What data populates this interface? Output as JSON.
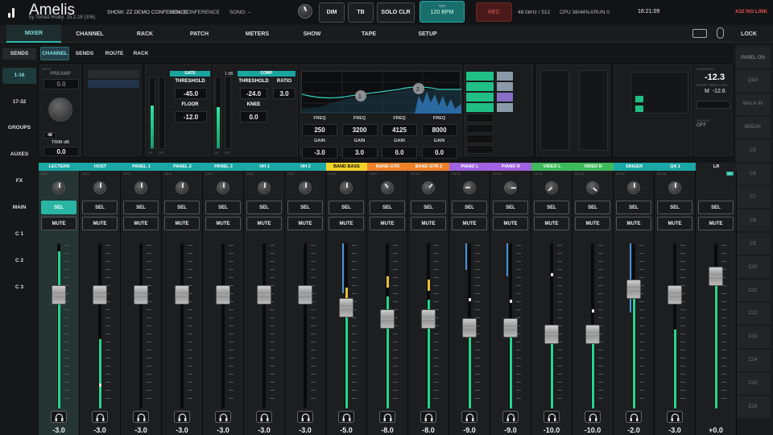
{
  "app": {
    "name": "Amelis",
    "by": "by Tomáš Hrubý",
    "version": "15.2.18 (306)",
    "show": "SHOW: ZZ DEMO CONFERENCE",
    "scene": "SCN: CONFERENCE",
    "song": "SONG: --",
    "dim": "DIM",
    "tb": "TB",
    "solo_clr": "SOLO CLR",
    "tap_label": "TAP",
    "bpm": "120 BPM",
    "rec": "REC",
    "samplerate": "48.0kHz / 512",
    "cpu": "CPU 38/44%",
    "xrun": "XRUN 0",
    "clock": "16:21:09",
    "link": "X32 NO LINK"
  },
  "nav": [
    "MIXER",
    "CHANNEL",
    "RACK",
    "PATCH",
    "METERS",
    "SHOW",
    "TAPE",
    "SETUP"
  ],
  "nav_lock": "LOCK",
  "left": [
    "SENDS",
    "1-16",
    "17-32",
    "GROUPS",
    "AUXES",
    "FX",
    "MAIN",
    "C 1",
    "C 2",
    "C 3"
  ],
  "sendtabs": [
    "CHANNEL",
    "SENDS",
    "ROUTE",
    "RACK"
  ],
  "right": [
    "PANEL ON",
    "Q&A",
    "WALK-IN",
    "BREAK",
    "C5",
    "C6",
    "C7",
    "C8",
    "C9",
    "C10",
    "C11",
    "C12",
    "C13",
    "C14",
    "C15",
    "C16"
  ],
  "chs": {
    "preamp": "PREAMP",
    "preamp_val": "0.0",
    "trim_label": "TRIM dB",
    "trim_val": "0.0",
    "knob_sub": "48",
    "gate": "GATE",
    "threshold": "THRESHOLD",
    "gate_thr": "-45.0",
    "floor": "FLOOR",
    "gate_floor": "-12.0",
    "in": "IN",
    "gr": "GR",
    "db1": "1 dB",
    "comp": "COMP",
    "comp_thr_l": "THRESHOLD",
    "comp_thr": "-24.0",
    "ratio_l": "RATIO",
    "ratio": "3.0",
    "knee_l": "KNEE",
    "knee": "0.0",
    "eq_bands": [
      {
        "freq": "250",
        "gain": "-3.0"
      },
      {
        "freq": "3200",
        "gain": "3.0"
      },
      {
        "freq": "4125",
        "gain": "0.0"
      },
      {
        "freq": "8000",
        "gain": "0.0"
      }
    ],
    "freq": "FREQ",
    "gain": "GAIN",
    "eq_n1": "1",
    "eq_n2": "2",
    "loudness": "-12.3",
    "loud_label": "SHORT-TERM LUFS",
    "loud_m": "M",
    "loud_m_val": "-12.6",
    "limiter_label": "LIMITER",
    "limiter": "OFF"
  },
  "channels": [
    {
      "name": "LECTERN",
      "num": "CH 1",
      "color": "#1aa7a5",
      "gain": "-3.0",
      "fader": 0.69,
      "meter": 0.95,
      "sel": true,
      "knob": 0,
      "pre": 0,
      "peak": 0
    },
    {
      "name": "HOST",
      "num": "CH 2",
      "color": "#1aa7a5",
      "gain": "-3.0",
      "fader": 0.69,
      "meter": 0.42,
      "sel": false,
      "knob": 0,
      "pre": 0,
      "peak": 0.15
    },
    {
      "name": "PANEL 1",
      "num": "CH 3",
      "color": "#1aa7a5",
      "gain": "-3.0",
      "fader": 0.69,
      "meter": 0,
      "sel": false,
      "knob": 0,
      "pre": 0,
      "peak": 0
    },
    {
      "name": "PANEL 2",
      "num": "CH 4",
      "color": "#1aa7a5",
      "gain": "-3.0",
      "fader": 0.69,
      "meter": 0,
      "sel": false,
      "knob": 0,
      "pre": 0,
      "peak": 0
    },
    {
      "name": "PANEL 3",
      "num": "CH 5",
      "color": "#1aa7a5",
      "gain": "-3.0",
      "fader": 0.69,
      "meter": 0,
      "sel": false,
      "knob": 0,
      "pre": 0,
      "peak": 0
    },
    {
      "name": "HH 1",
      "num": "CH 6",
      "color": "#1aa7a5",
      "gain": "-3.0",
      "fader": 0.69,
      "meter": 0,
      "sel": false,
      "knob": 0,
      "pre": 0,
      "peak": 0
    },
    {
      "name": "HH 2",
      "num": "CH 7",
      "color": "#1aa7a5",
      "gain": "-3.0",
      "fader": 0.69,
      "meter": 0,
      "sel": false,
      "knob": 0,
      "pre": 0,
      "peak": 0
    },
    {
      "name": "BAND BASS",
      "num": "CH 8",
      "color": "#f1d22a",
      "gain": "-5.0",
      "fader": 0.61,
      "meter": 0.55,
      "sel": false,
      "knob": 0,
      "pre": 0.3,
      "peak": 0.73
    },
    {
      "name": "BAND GTR",
      "num": "CH 9",
      "color": "#f0822a",
      "gain": "-8.0",
      "fader": 0.54,
      "meter": 0.68,
      "sel": false,
      "knob": -40,
      "pre": 0,
      "peak": 0.8
    },
    {
      "name": "BAND GTR 2",
      "num": "CH 10",
      "color": "#f0822a",
      "gain": "-8.0",
      "fader": 0.54,
      "meter": 0.66,
      "sel": false,
      "knob": 40,
      "pre": 0,
      "peak": 0.78
    },
    {
      "name": "PIANO L",
      "num": "CH 11",
      "color": "#9f62e0",
      "gain": "-9.0",
      "fader": 0.49,
      "meter": 0.5,
      "sel": false,
      "knob": -90,
      "pre": 0.16,
      "peak": 0.67
    },
    {
      "name": "PIANO R",
      "num": "CH 12",
      "color": "#9f62e0",
      "gain": "-9.0",
      "fader": 0.49,
      "meter": 0.52,
      "sel": false,
      "knob": 90,
      "pre": 0.2,
      "peak": 0.66
    },
    {
      "name": "VIDEO L",
      "num": "CH 13",
      "color": "#3fba5a",
      "gain": "-10.0",
      "fader": 0.45,
      "meter": 0.48,
      "sel": false,
      "knob": -130,
      "pre": 0,
      "peak": 0.82
    },
    {
      "name": "VIDEO R",
      "num": "CH 14",
      "color": "#3fba5a",
      "gain": "-10.0",
      "fader": 0.45,
      "meter": 0.5,
      "sel": false,
      "knob": 130,
      "pre": 0,
      "peak": 0.6
    },
    {
      "name": "SINGER",
      "num": "CH 15",
      "color": "#1aa7a5",
      "gain": "-2.0",
      "fader": 0.72,
      "meter": 0.67,
      "sel": false,
      "knob": 0,
      "pre": 0.42,
      "peak": 0
    },
    {
      "name": "QA 1",
      "num": "CH 16",
      "color": "#1aa7a5",
      "gain": "-3.0",
      "fader": 0.69,
      "meter": 0.48,
      "sel": false,
      "knob": 0,
      "pre": 0,
      "peak": 0
    }
  ],
  "master": {
    "name": "LR",
    "gain": "+0.0",
    "fader": 0.8,
    "meter": 0.84,
    "sel_label": "SEL",
    "mute_label": "MUTE",
    "badge": "ST"
  },
  "labels": {
    "sel": "SEL",
    "mute": "MUTE"
  },
  "colors": {
    "accent": "#2ab5a3"
  }
}
